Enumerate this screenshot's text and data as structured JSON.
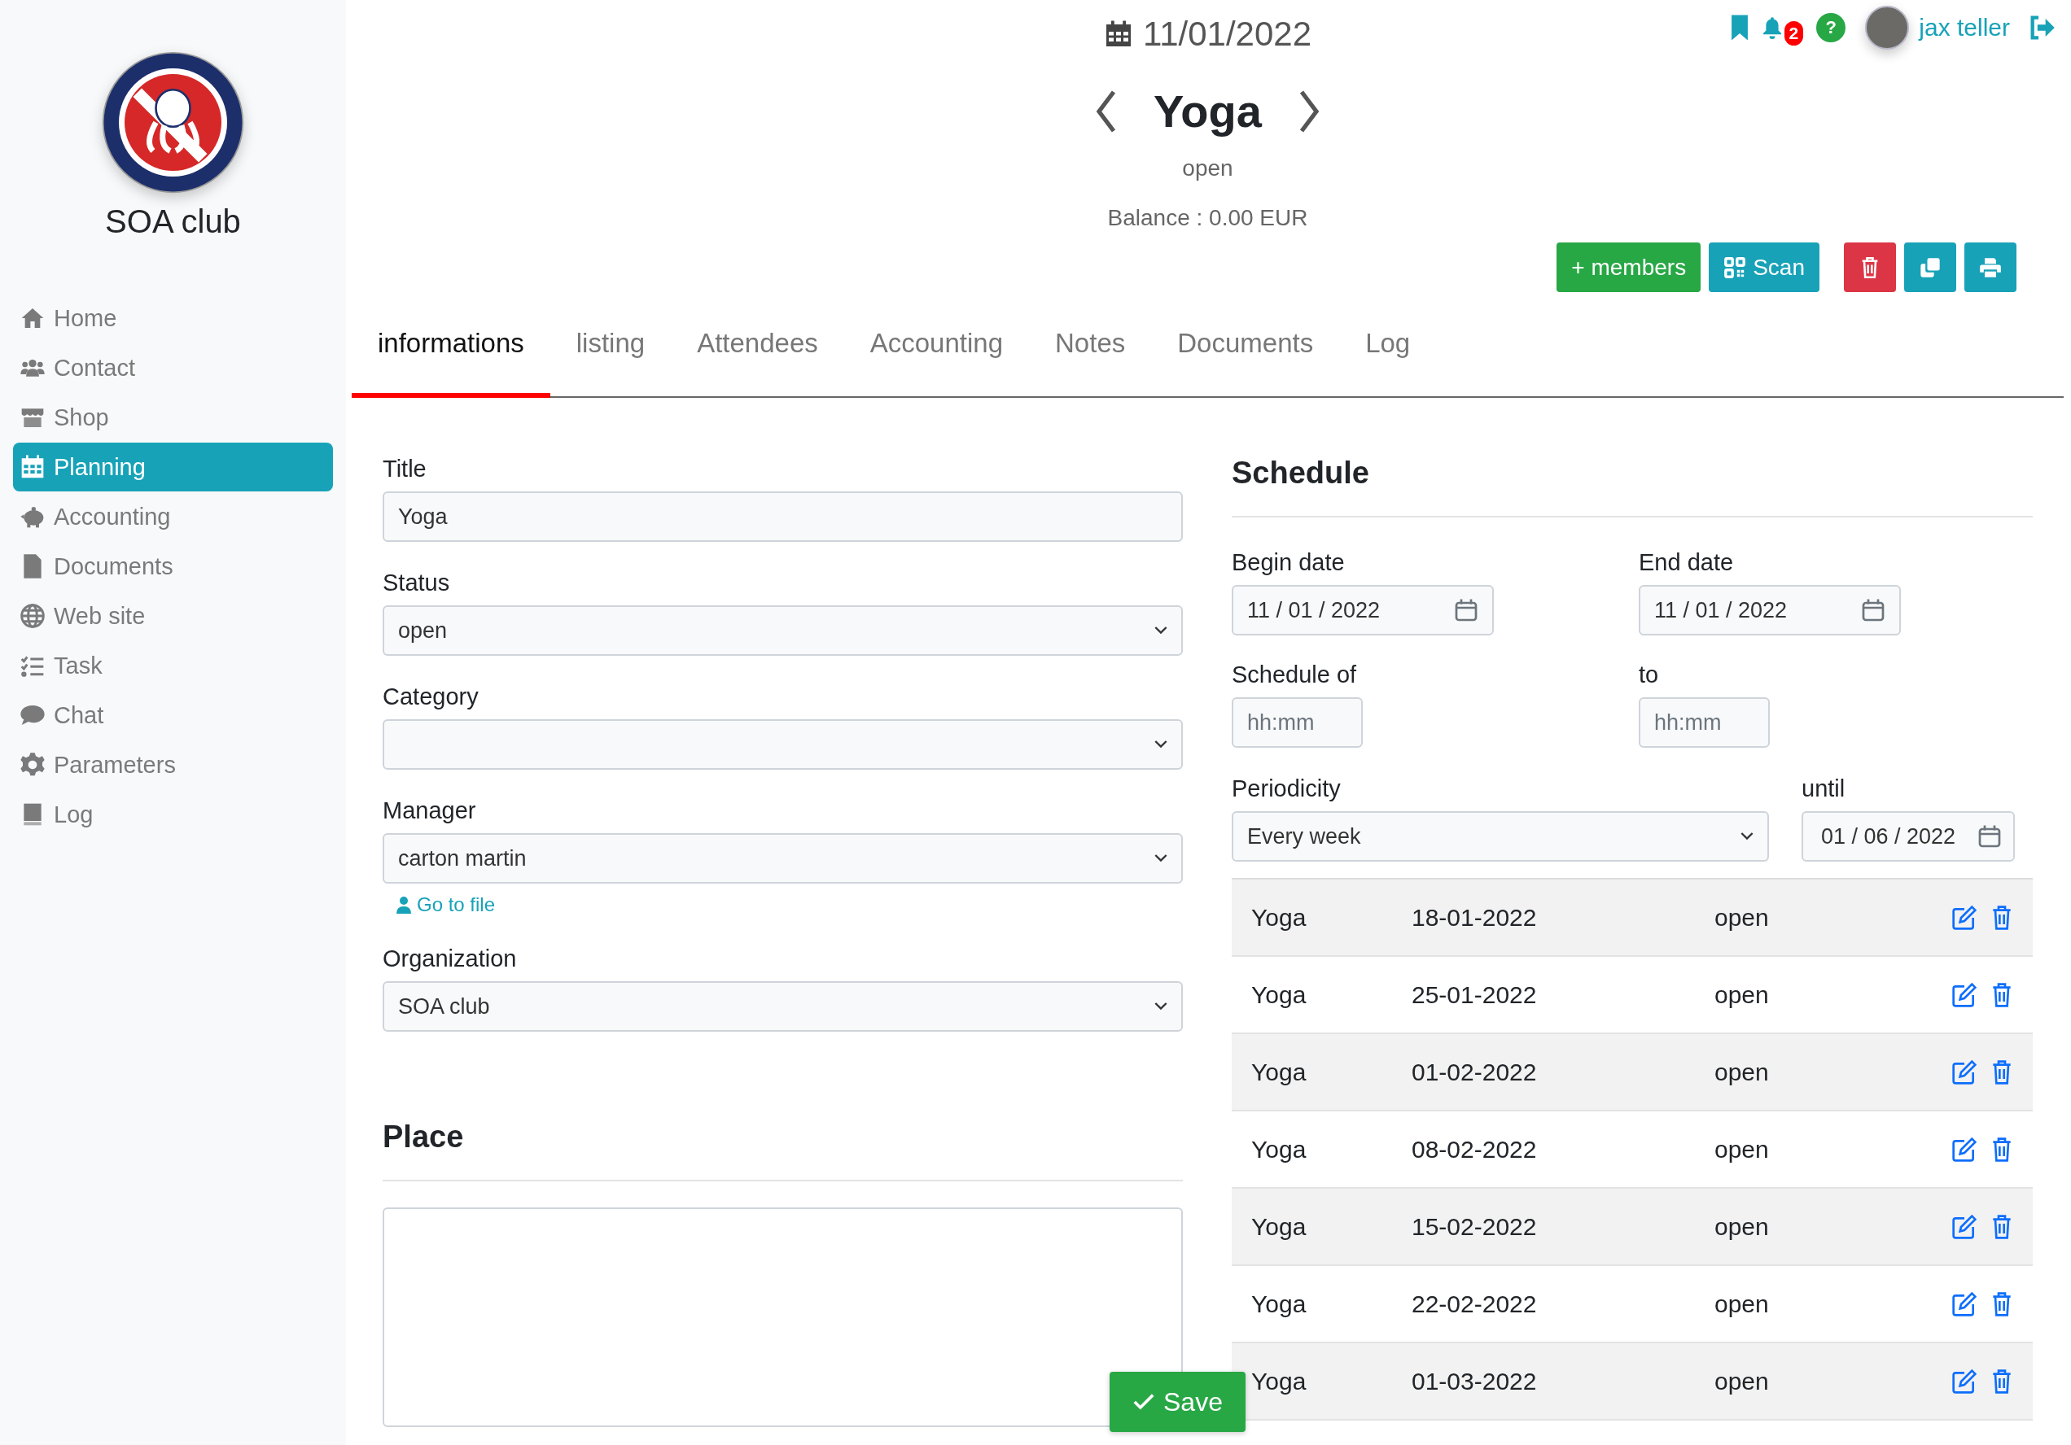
{
  "sidebar": {
    "club_name": "SOA club",
    "items": [
      {
        "label": "Home",
        "selected": false
      },
      {
        "label": "Contact",
        "selected": false
      },
      {
        "label": "Shop",
        "selected": false
      },
      {
        "label": "Planning",
        "selected": true
      },
      {
        "label": "Accounting",
        "selected": false
      },
      {
        "label": "Documents",
        "selected": false
      },
      {
        "label": "Web site",
        "selected": false
      },
      {
        "label": "Task",
        "selected": false
      },
      {
        "label": "Chat",
        "selected": false
      },
      {
        "label": "Parameters",
        "selected": false
      },
      {
        "label": "Log",
        "selected": false
      }
    ]
  },
  "user_bar": {
    "notification_count": "2",
    "help": "?",
    "user_name": "jax teller"
  },
  "header": {
    "date": "11/01/2022",
    "title": "Yoga",
    "status": "open",
    "balance": "Balance : 0.00 EUR"
  },
  "actions": {
    "members": "+ members",
    "scan": "Scan"
  },
  "tabs": [
    {
      "label": "informations",
      "selected": true
    },
    {
      "label": "listing",
      "selected": false
    },
    {
      "label": "Attendees",
      "selected": false
    },
    {
      "label": "Accounting",
      "selected": false
    },
    {
      "label": "Notes",
      "selected": false
    },
    {
      "label": "Documents",
      "selected": false
    },
    {
      "label": "Log",
      "selected": false
    }
  ],
  "form": {
    "title": {
      "label": "Title",
      "value": "Yoga"
    },
    "status": {
      "label": "Status",
      "value": "open"
    },
    "category": {
      "label": "Category"
    },
    "manager": {
      "label": "Manager",
      "value": "carton martin",
      "link": "Go to file"
    },
    "organization": {
      "label": "Organization",
      "value": "SOA club"
    },
    "place_heading": "Place"
  },
  "schedule": {
    "heading": "Schedule",
    "begin": {
      "label": "Begin date",
      "value": "11 / 01 / 2022"
    },
    "end": {
      "label": "End date",
      "value": "11 / 01 / 2022"
    },
    "from": {
      "label": "Schedule of",
      "placeholder": "hh:mm"
    },
    "to": {
      "label": "to",
      "placeholder": "hh:mm"
    },
    "periodicity": {
      "label": "Periodicity",
      "value": "Every week"
    },
    "until": {
      "label": "until",
      "value": "01 / 06 / 2022"
    },
    "rows": [
      {
        "name": "Yoga",
        "date": "18-01-2022",
        "status": "open"
      },
      {
        "name": "Yoga",
        "date": "25-01-2022",
        "status": "open"
      },
      {
        "name": "Yoga",
        "date": "01-02-2022",
        "status": "open"
      },
      {
        "name": "Yoga",
        "date": "08-02-2022",
        "status": "open"
      },
      {
        "name": "Yoga",
        "date": "15-02-2022",
        "status": "open"
      },
      {
        "name": "Yoga",
        "date": "22-02-2022",
        "status": "open"
      },
      {
        "name": "Yoga",
        "date": "01-03-2022",
        "status": "open"
      }
    ]
  },
  "save_button": "Save"
}
